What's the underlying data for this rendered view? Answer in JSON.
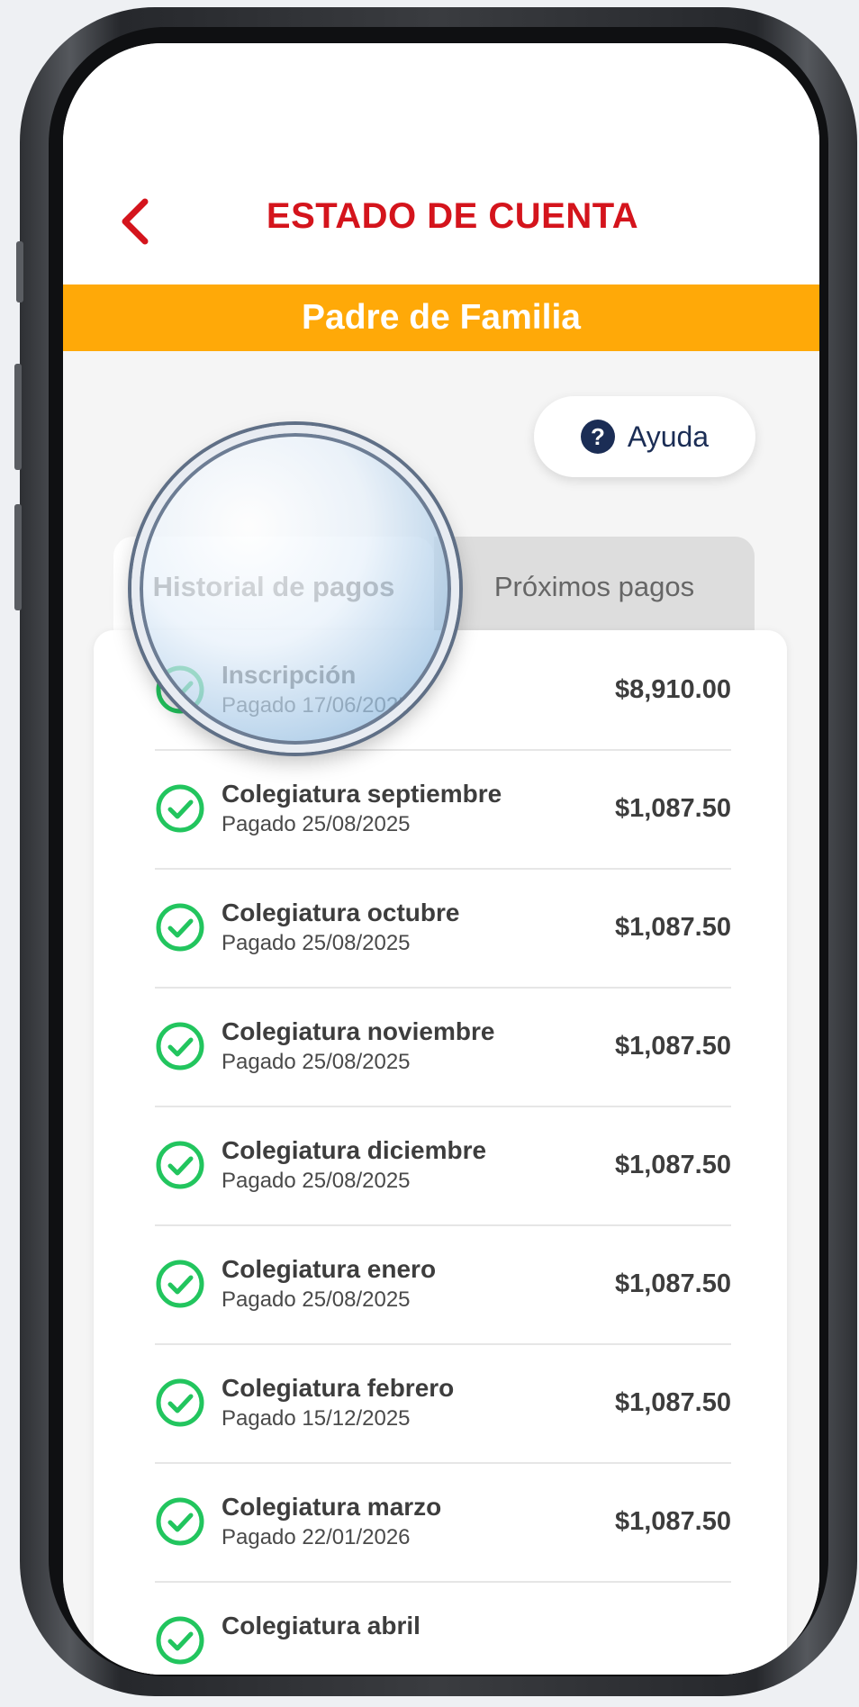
{
  "header": {
    "title": "ESTADO DE CUENTA",
    "back_icon": "chevron-left-icon"
  },
  "role_bar": {
    "label": "Padre de Familia"
  },
  "help": {
    "label": "Ayuda",
    "icon": "question-circle-icon"
  },
  "tabs": [
    {
      "label": "Historial de pagos",
      "active": true
    },
    {
      "label": "Próximos pagos",
      "active": false
    }
  ],
  "payments": [
    {
      "name": "Inscripción",
      "date": "Pagado 17/06/2025",
      "amount": "$8,910.00"
    },
    {
      "name": "Colegiatura septiembre",
      "date": "Pagado 25/08/2025",
      "amount": "$1,087.50"
    },
    {
      "name": "Colegiatura octubre",
      "date": "Pagado 25/08/2025",
      "amount": "$1,087.50"
    },
    {
      "name": "Colegiatura noviembre",
      "date": "Pagado 25/08/2025",
      "amount": "$1,087.50"
    },
    {
      "name": "Colegiatura diciembre",
      "date": "Pagado 25/08/2025",
      "amount": "$1,087.50"
    },
    {
      "name": "Colegiatura enero",
      "date": "Pagado 25/08/2025",
      "amount": "$1,087.50"
    },
    {
      "name": "Colegiatura febrero",
      "date": "Pagado 15/12/2025",
      "amount": "$1,087.50"
    },
    {
      "name": "Colegiatura marzo",
      "date": "Pagado 22/01/2026",
      "amount": "$1,087.50"
    },
    {
      "name": "Colegiatura abril",
      "date": "",
      "amount": ""
    }
  ],
  "colors": {
    "accent_red": "#d4141c",
    "role_bar": "#ffa908",
    "check_green": "#22c55e",
    "help_navy": "#1b2d55"
  }
}
